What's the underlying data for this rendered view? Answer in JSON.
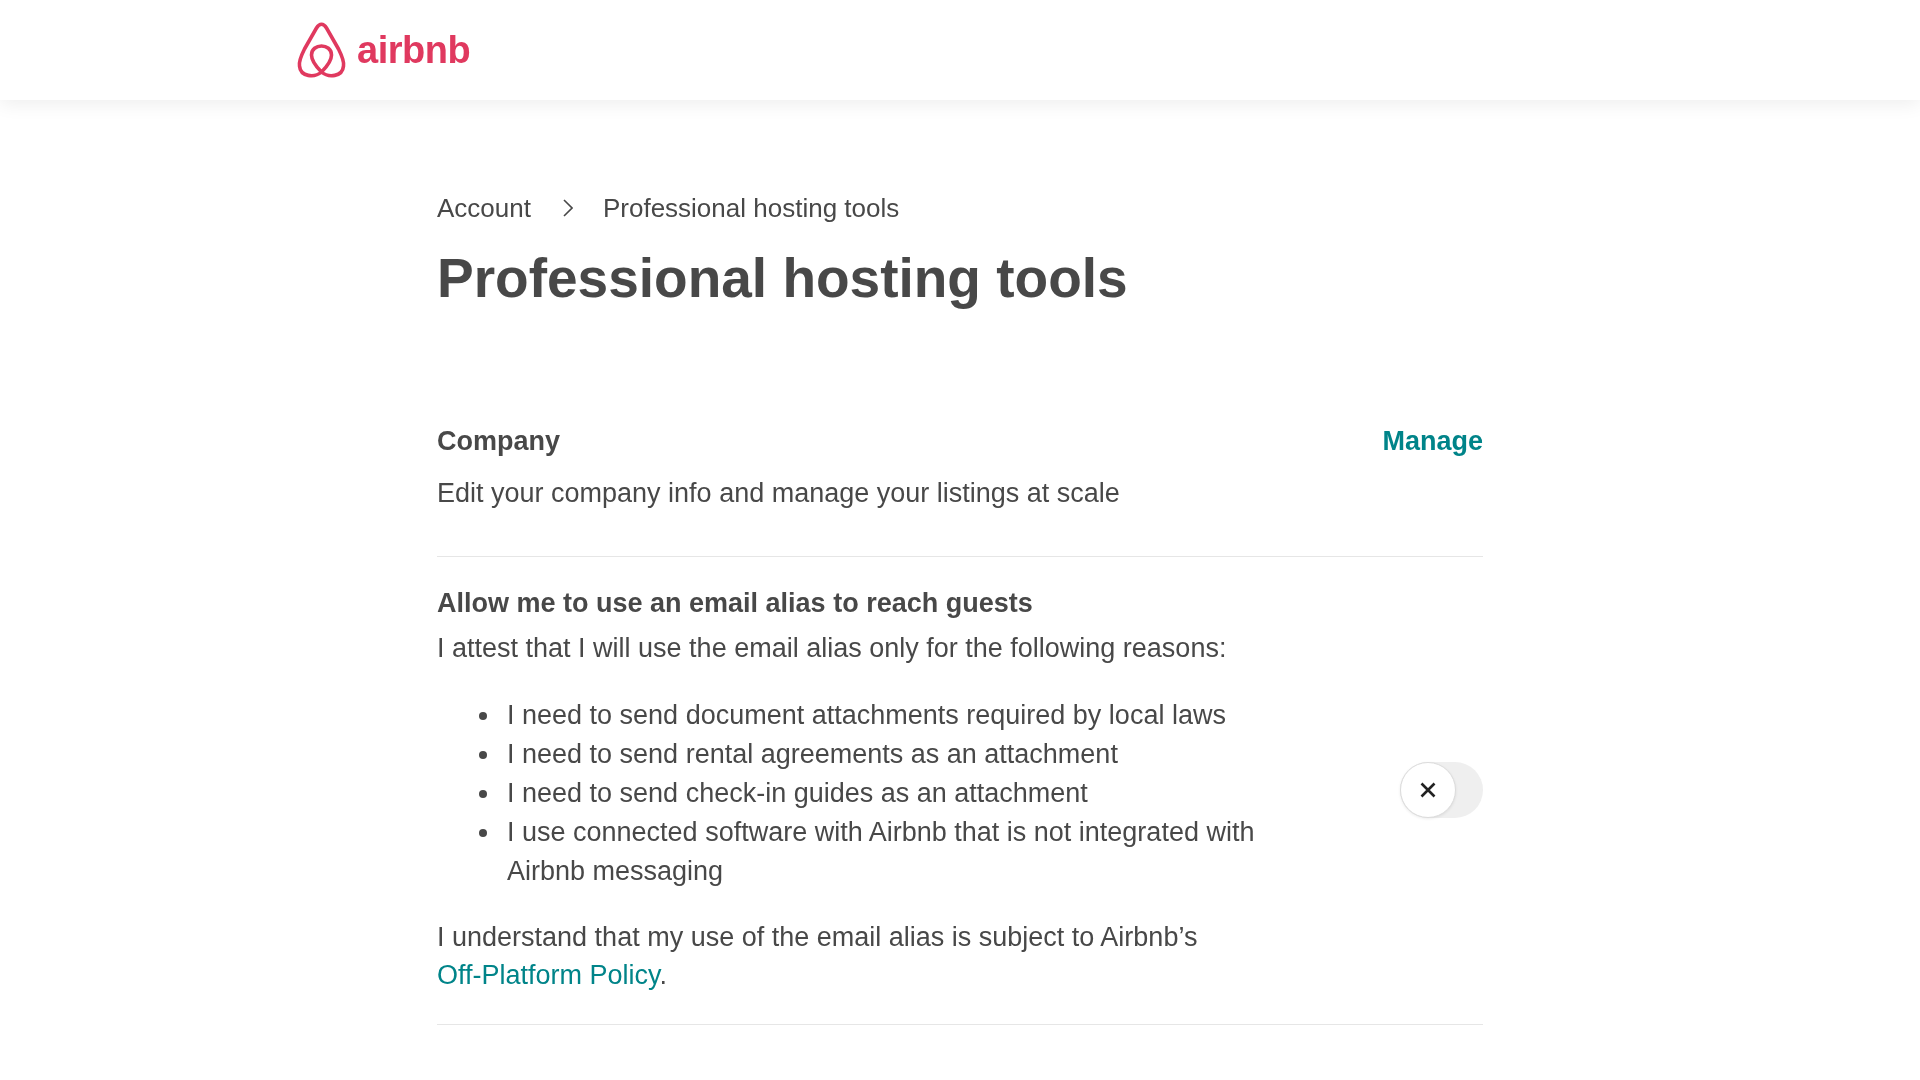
{
  "header": {
    "logo_text": "airbnb"
  },
  "breadcrumb": [
    "Account",
    "Professional hosting tools"
  ],
  "title": "Professional hosting tools",
  "company": {
    "heading": "Company",
    "action": "Manage",
    "description": "Edit your company info and manage your listings at scale"
  },
  "email_alias": {
    "heading": "Allow me to use an email alias to reach guests",
    "intro": "I attest that I will use the email alias only for the following reasons:",
    "reasons": [
      "I need to send document attachments required by local laws",
      "I need to send rental agreements as an attachment",
      "I need to send check-in guides as an attachment",
      "I use connected software with Airbnb that is not integrated with Airbnb messaging"
    ],
    "note": {
      "before": "I understand that my use of the email alias is subject to Airbnb’s",
      "link": "Off-Platform Policy",
      "after": "."
    },
    "on": false
  }
}
